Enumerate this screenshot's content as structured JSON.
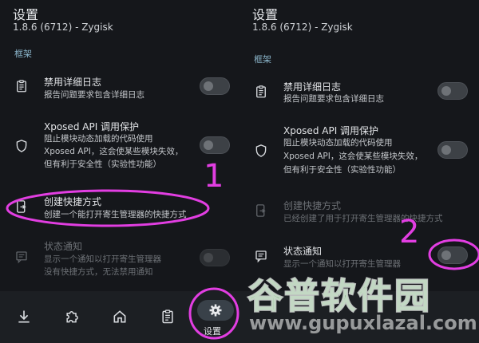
{
  "left": {
    "title": "设置",
    "subtitle": "1.8.6 (6712) - Zygisk",
    "section": "框架",
    "items": [
      {
        "title": "禁用详细日志",
        "desc": [
          "报告问题要求包含详细日志"
        ]
      },
      {
        "title": "Xposed API 调用保护",
        "desc": [
          "阻止模块动态加载的代码使用",
          "Xposed API，这会使某些模块失效，",
          "但有利于安全性（实验性功能）"
        ]
      },
      {
        "title": "创建快捷方式",
        "desc": [
          "创建一个能打开寄生管理器的快捷方式"
        ]
      },
      {
        "title": "状态通知",
        "desc": [
          "显示一个通知以打开寄生管理器",
          "没有快捷方式，无法禁用通知"
        ]
      }
    ],
    "nav_label": "设置"
  },
  "right": {
    "title": "设置",
    "subtitle": "1.8.6 (6712) - Zygisk",
    "section": "框架",
    "items": [
      {
        "title": "禁用详细日志",
        "desc": [
          "报告问题要求包含详细日志"
        ]
      },
      {
        "title": "Xposed API 调用保护",
        "desc": [
          "阻止模块动态加载的代码使用",
          "Xposed API，这会使某些模块失效，",
          "但有利于安全性（实验性功能）"
        ]
      },
      {
        "title": "创建快捷方式",
        "desc": [
          "已经创建了用于打开寄生管理器的快捷方式"
        ]
      },
      {
        "title": "状态通知",
        "desc": [
          "显示一个通知以打开寄生管理器"
        ]
      }
    ]
  },
  "annotations": {
    "step1": "1",
    "step2": "2"
  },
  "watermark": {
    "name": "谷普软件园",
    "url": "www.gupuxlazal.com"
  },
  "colors": {
    "annotation": "#e23ee2",
    "accent": "#8ab4c9"
  }
}
